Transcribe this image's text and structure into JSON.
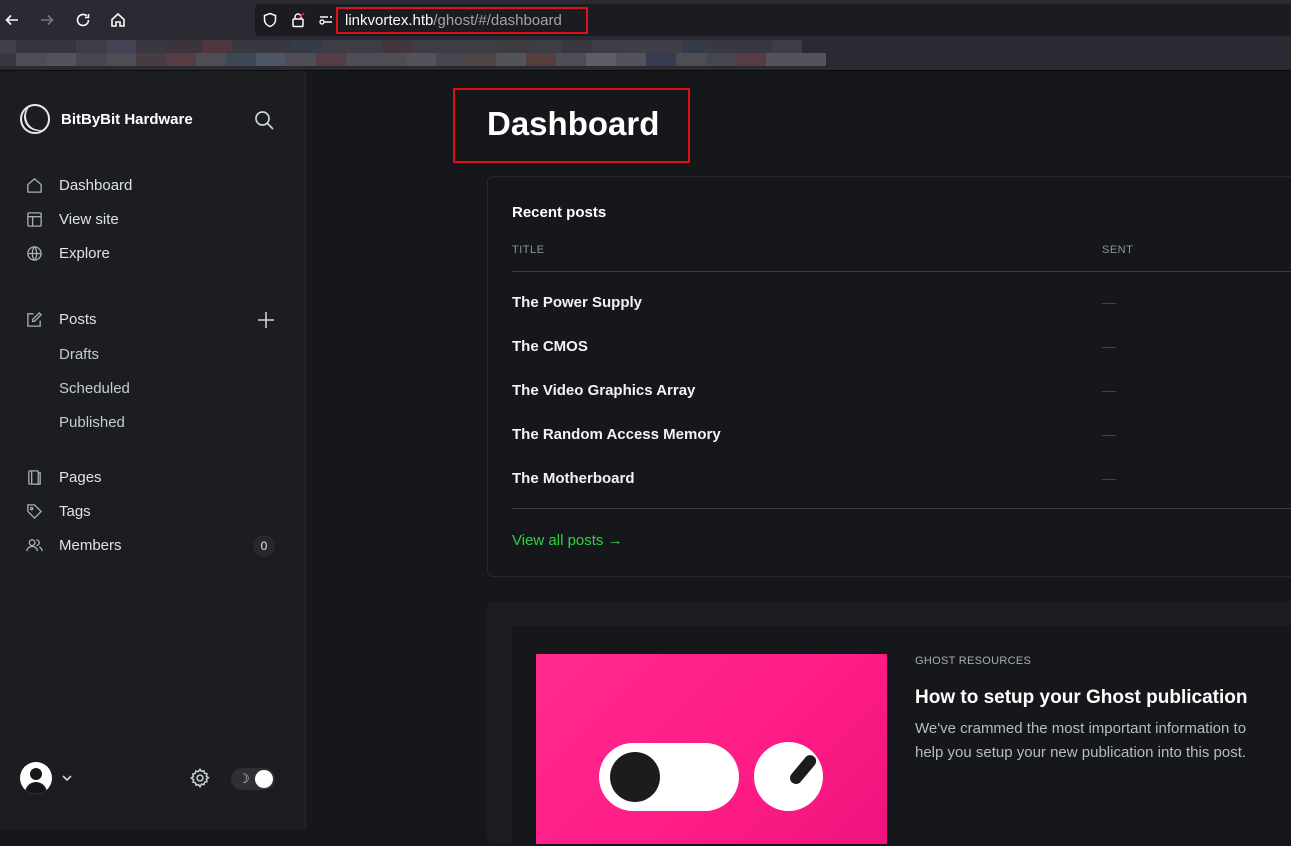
{
  "browser": {
    "url_host": "linkvortex.htb",
    "url_path": "/ghost/#/dashboard"
  },
  "sidebar": {
    "brand": "BitByBit Hardware",
    "nav": [
      {
        "label": "Dashboard",
        "icon": "home-icon"
      },
      {
        "label": "View site",
        "icon": "layout-icon"
      },
      {
        "label": "Explore",
        "icon": "globe-icon"
      }
    ],
    "posts": {
      "label": "Posts",
      "icon": "edit-icon",
      "sub": [
        "Drafts",
        "Scheduled",
        "Published"
      ]
    },
    "more": [
      {
        "label": "Pages",
        "icon": "page-icon"
      },
      {
        "label": "Tags",
        "icon": "tag-icon"
      },
      {
        "label": "Members",
        "icon": "members-icon",
        "count": "0"
      }
    ],
    "theme_icon": "☽"
  },
  "main": {
    "title": "Dashboard",
    "recent": {
      "title": "Recent posts",
      "col_title": "TITLE",
      "col_sent": "SENT",
      "posts": [
        "The Power Supply",
        "The CMOS",
        "The Video Graphics Array",
        "The Random Access Memory",
        "The Motherboard"
      ],
      "view_all": "View all posts →"
    },
    "resources": {
      "label": "GHOST RESOURCES",
      "title": "How to setup your Ghost publication",
      "desc": "We've crammed the most important information to help you setup your new publication into this post."
    }
  },
  "colors": {
    "accent_green": "#30cf43",
    "highlight_red": "#e0101a",
    "resource_pink": "#ff1d86"
  }
}
